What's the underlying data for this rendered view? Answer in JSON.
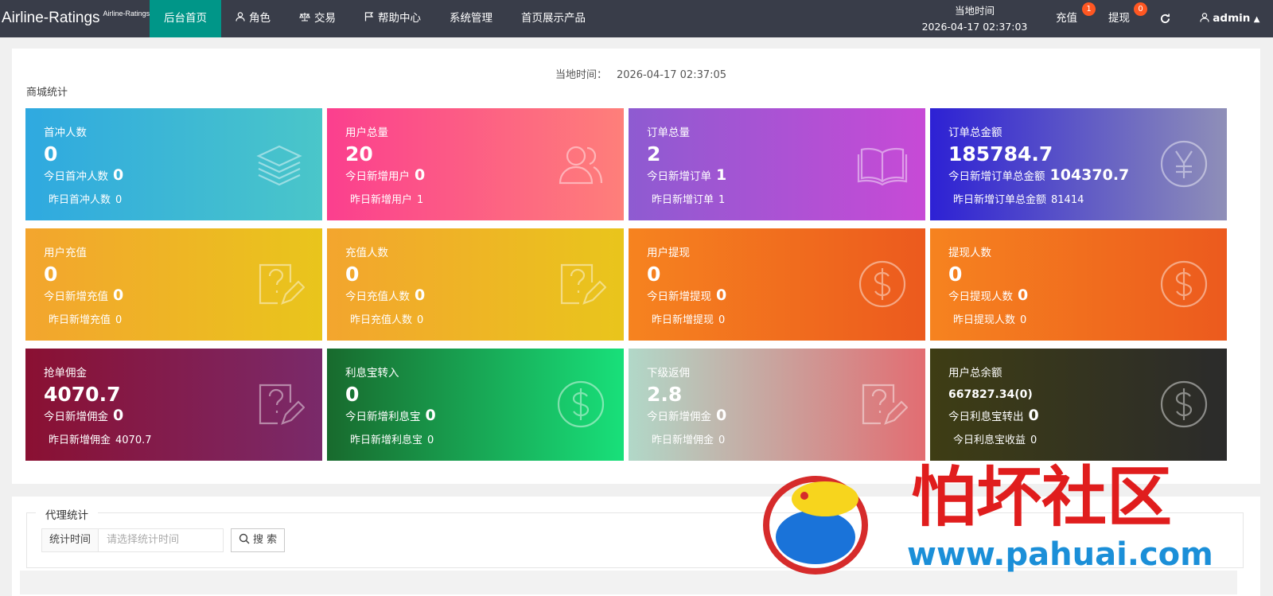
{
  "header": {
    "brand": "Airline-Ratings",
    "brand_sup": "Airline-Ratings",
    "nav": [
      {
        "label": "后台首页",
        "icon": ""
      },
      {
        "label": "角色",
        "icon": "user-icon"
      },
      {
        "label": "交易",
        "icon": "scale-icon"
      },
      {
        "label": "帮助中心",
        "icon": "flag-icon"
      },
      {
        "label": "系统管理",
        "icon": ""
      },
      {
        "label": "首页展示产品",
        "icon": ""
      }
    ],
    "clock_label": "当地时间",
    "clock_time": "2026-04-17 02:37:03",
    "recharge_label": "充值",
    "recharge_badge": "1",
    "withdraw_label": "提现",
    "withdraw_badge": "0",
    "refresh_icon": "refresh-icon",
    "user": "admin"
  },
  "main": {
    "local_time_label": "当地时间：",
    "local_time": "2026-04-17 02:37:05",
    "section_title": "商城统计",
    "cards": [
      {
        "title": "首冲人数",
        "value": "0",
        "today_label": "今日首冲人数",
        "today": "0",
        "yest_label": "昨日首冲人数",
        "yest": "0",
        "icon": "layers-icon",
        "colors": [
          "#2fa9e0",
          "#4ac6c9"
        ]
      },
      {
        "title": "用户总量",
        "value": "20",
        "today_label": "今日新增用户",
        "today": "0",
        "yest_label": "昨日新增用户",
        "yest": "1",
        "icon": "users-icon",
        "colors": [
          "#fb3f8e",
          "#fe7f7a"
        ]
      },
      {
        "title": "订单总量",
        "value": "2",
        "today_label": "今日新增订单",
        "today": "1",
        "yest_label": "昨日新增订单",
        "yest": "1",
        "icon": "book-icon",
        "colors": [
          "#8e5bd1",
          "#c74ad6"
        ]
      },
      {
        "title": "订单总金额",
        "value": "185784.7",
        "today_label": "今日新增订单总金额",
        "today": "104370.7",
        "yest_label": "昨日新增订单总金额",
        "yest": "81414",
        "icon": "yen-icon",
        "colors": [
          "#2d21d4",
          "#8f8fb8"
        ]
      },
      {
        "title": "用户充值",
        "value": "0",
        "today_label": "今日新增充值",
        "today": "0",
        "yest_label": "昨日新增充值",
        "yest": "0",
        "icon": "edit-question-icon",
        "colors": [
          "#f3a52e",
          "#e9c51c"
        ]
      },
      {
        "title": "充值人数",
        "value": "0",
        "today_label": "今日充值人数",
        "today": "0",
        "yest_label": "昨日充值人数",
        "yest": "0",
        "icon": "edit-question-icon",
        "colors": [
          "#f3a52e",
          "#e9c51c"
        ]
      },
      {
        "title": "用户提现",
        "value": "0",
        "today_label": "今日新增提现",
        "today": "0",
        "yest_label": "昨日新增提现",
        "yest": "0",
        "icon": "dollar-icon",
        "colors": [
          "#f6831f",
          "#ec5a1e"
        ]
      },
      {
        "title": "提现人数",
        "value": "0",
        "today_label": "今日提现人数",
        "today": "0",
        "yest_label": "昨日提现人数",
        "yest": "0",
        "icon": "dollar-icon",
        "colors": [
          "#f6831f",
          "#ec5a1e"
        ]
      },
      {
        "title": "抢单佣金",
        "value": "4070.7",
        "today_label": "今日新增佣金",
        "today": "0",
        "yest_label": "昨日新增佣金",
        "yest": "4070.7",
        "icon": "edit-question-icon",
        "colors": [
          "#8a1032",
          "#7a2a6a"
        ]
      },
      {
        "title": "利息宝转入",
        "value": "0",
        "today_label": "今日新增利息宝",
        "today": "0",
        "yest_label": "昨日新增利息宝",
        "yest": "0",
        "icon": "dollar-icon",
        "colors": [
          "#186a2d",
          "#18e07a"
        ]
      },
      {
        "title": "下级返佣",
        "value": "2.8",
        "today_label": "今日新增佣金",
        "today": "0",
        "yest_label": "昨日新增佣金",
        "yest": "0",
        "icon": "edit-question-icon",
        "colors": [
          "#b1d8c8",
          "#e26d72"
        ]
      },
      {
        "title": "用户总余额",
        "value": "667827.34(0)",
        "today_label": "今日利息宝转出",
        "today": "0",
        "yest_label": "今日利息宝收益",
        "yest": "0",
        "icon": "dollar-icon",
        "colors": [
          "#3e3d14",
          "#2b2b2b"
        ]
      }
    ]
  },
  "agent": {
    "legend": "代理统计",
    "time_label": "统计时间",
    "time_placeholder": "请选择统计时间",
    "search_label": "搜 索"
  },
  "watermark": {
    "text": "怕坏社区",
    "url": "www.pahuai.com"
  }
}
